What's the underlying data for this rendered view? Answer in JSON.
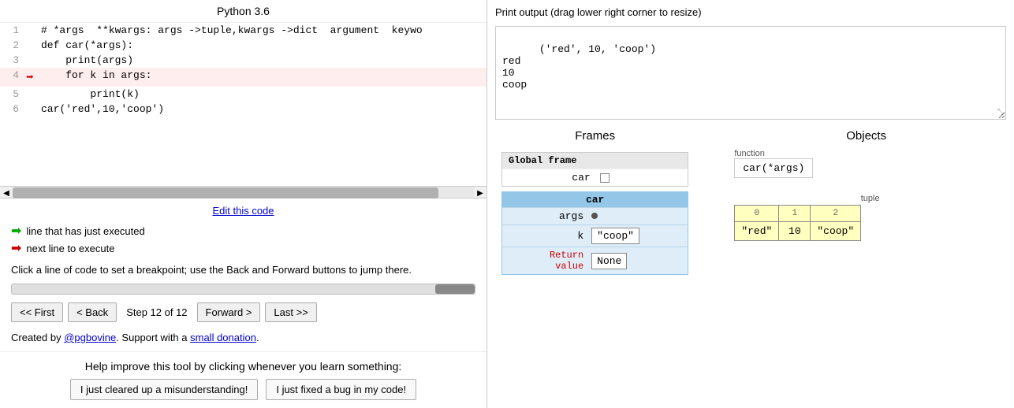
{
  "left": {
    "title": "Python 3.6",
    "code_lines": [
      {
        "num": 1,
        "arrow": "",
        "text": "# *args  **kwargs: args ->tuple,kwargs ->dict  argument  keywo",
        "highlight": false
      },
      {
        "num": 2,
        "arrow": "",
        "text": "def car(*args):",
        "highlight": false
      },
      {
        "num": 3,
        "arrow": "",
        "text": "    print(args)",
        "highlight": false
      },
      {
        "num": 4,
        "arrow": "red",
        "text": "    for k in args:",
        "highlight": true
      },
      {
        "num": 5,
        "arrow": "",
        "text": "        print(k)",
        "highlight": false
      },
      {
        "num": 6,
        "arrow": "",
        "text": "car('red',10,'coop')",
        "highlight": false
      }
    ],
    "edit_link": "Edit this code",
    "legend": {
      "green_text": "line that has just executed",
      "red_text": "next line to execute"
    },
    "breakpoint_text": "Click a line of code to set a breakpoint; use the Back and Forward buttons to jump there.",
    "nav": {
      "first": "<< First",
      "back": "< Back",
      "step": "Step 12 of 12",
      "forward": "Forward >",
      "last": "Last >>"
    },
    "created_by": "Created by ",
    "creator": "@pgbovine",
    "created_mid": ". Support with a ",
    "donation": "small donation",
    "created_end": ".",
    "help_title": "Help improve this tool by clicking whenever you learn something:",
    "help_btn1": "I just cleared up a misunderstanding!",
    "help_btn2": "I just fixed a bug in my code!"
  },
  "right": {
    "print_label": "Print output (drag lower right corner to resize)",
    "print_output": "('red', 10, 'coop')\nred\n10\ncoop",
    "frames_header": "Frames",
    "objects_header": "Objects",
    "global_frame_title": "Global frame",
    "global_var": "car",
    "function_label": "function",
    "function_text": "car(*args)",
    "tuple_label": "tuple",
    "tuple_indices": [
      "0",
      "1",
      "2"
    ],
    "tuple_values": [
      "\"red\"",
      "10",
      "\"coop\""
    ],
    "car_frame_title": "car",
    "car_rows": [
      {
        "var": "args",
        "val": "•",
        "type": "pointer"
      },
      {
        "var": "k",
        "val": "\"coop\"",
        "type": "text"
      },
      {
        "var": "Return\nvalue",
        "val": "None",
        "type": "text",
        "return": true
      }
    ]
  }
}
